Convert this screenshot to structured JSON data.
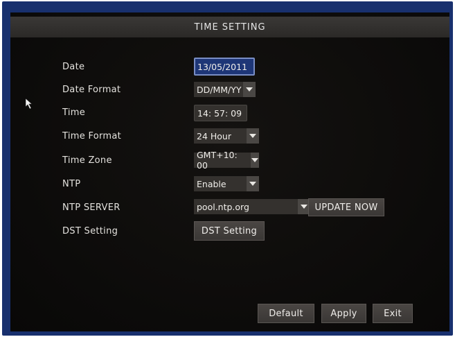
{
  "title": "TIME SETTING",
  "labels": {
    "date": "Date",
    "date_format": "Date Format",
    "time": "Time",
    "time_format": "Time Format",
    "time_zone": "Time Zone",
    "ntp": "NTP",
    "ntp_server": "NTP SERVER",
    "dst_setting": "DST Setting"
  },
  "values": {
    "date": "13/05/2011",
    "date_format": "DD/MM/YY",
    "time": "14: 57: 09",
    "time_format": "24 Hour",
    "time_zone": "GMT+10: 00",
    "ntp": "Enable",
    "ntp_server": "pool.ntp.org"
  },
  "buttons": {
    "update_now": "UPDATE NOW",
    "dst_setting": "DST Setting",
    "default": "Default",
    "apply": "Apply",
    "exit": "Exit"
  },
  "icons": {
    "dropdown": "chevron-down-icon",
    "cursor": "mouse-pointer-icon"
  },
  "colors": {
    "frame": "#18306e",
    "active_field": "#1e3677",
    "panel": "#0c0b0a"
  }
}
